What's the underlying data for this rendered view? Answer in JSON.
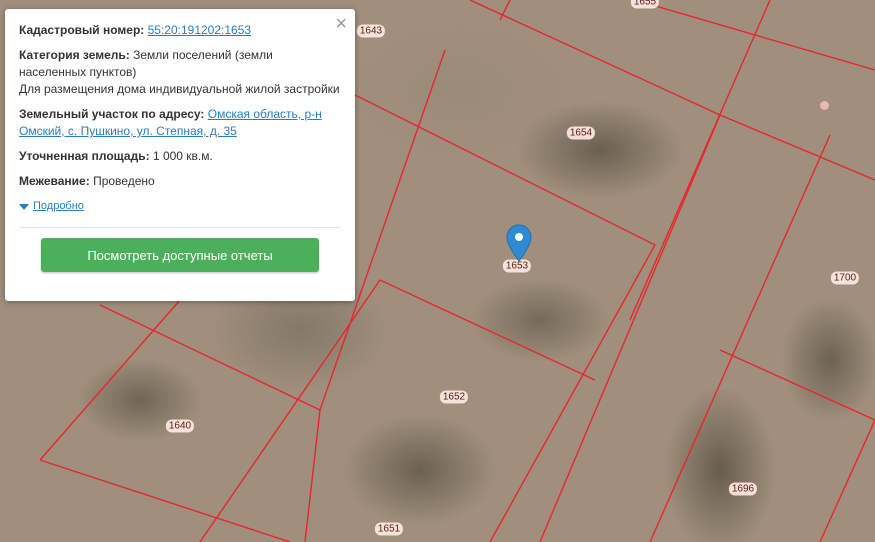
{
  "popup": {
    "cadastral_label": "Кадастровый номер:",
    "cadastral_value": "55:20:191202:1653",
    "category_label": "Категория земель:",
    "category_value": "Земли поселений (земли населенных пунктов)",
    "usage_value": "Для размещения дома индивидуальной жилой застройки",
    "address_label": "Земельный участок по адресу:",
    "address_value": "Омская область, р-н Омский, с. Пушкино, ул. Степная, д. 35",
    "area_label": "Уточненная площадь:",
    "area_value": "1 000 кв.м.",
    "survey_label": "Межевание:",
    "survey_value": "Проведено",
    "details_label": "Подробно",
    "reports_button": "Посмотреть доступные отчеты",
    "close_icon": "×"
  },
  "parcels": {
    "1643": "1643",
    "1655": "1655",
    "1654": "1654",
    "1653": "1653",
    "1700": "1700",
    "1652": "1652",
    "1640": "1640",
    "1696": "1696",
    "1651": "1651"
  },
  "colors": {
    "parcel_border": "#e8262b",
    "marker": "#2f8ad4",
    "button": "#4cb05a",
    "link": "#2b7bc0"
  }
}
